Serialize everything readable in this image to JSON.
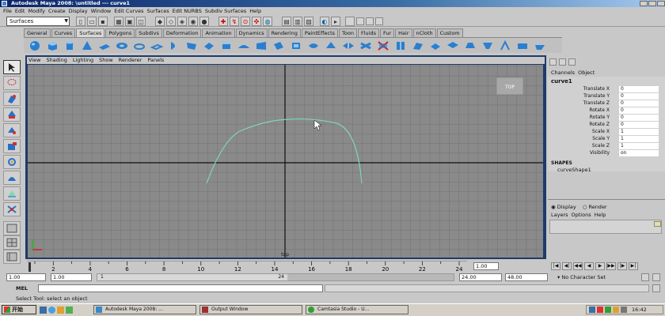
{
  "window": {
    "title": "Autodesk Maya 2008: \\untitled   ---   curve1"
  },
  "menubar": [
    "File",
    "Edit",
    "Modify",
    "Create",
    "Display",
    "Window",
    "Edit Curves",
    "Surfaces",
    "Edit NURBS",
    "Subdiv Surfaces",
    "Help"
  ],
  "status_line": {
    "mode": "Surfaces"
  },
  "shelf": {
    "tabs": [
      "General",
      "Curves",
      "Surfaces",
      "Polygons",
      "Subdivs",
      "Deformation",
      "Animation",
      "Dynamics",
      "Rendering",
      "PaintEffects",
      "Toon",
      "Fluids",
      "Fur",
      "Hair",
      "nCloth",
      "Custom"
    ],
    "active_tab": "Surfaces"
  },
  "panel_menu": [
    "View",
    "Shading",
    "Lighting",
    "Show",
    "Renderer",
    "Panels"
  ],
  "viewport": {
    "view_cube_label": "TOP",
    "camera_label": "top",
    "curve_color": "#7fd6b8"
  },
  "channel_box": {
    "menu": [
      "Channels",
      "Object"
    ],
    "object_name": "curve1",
    "attributes": [
      {
        "label": "Translate X",
        "value": "0"
      },
      {
        "label": "Translate Y",
        "value": "0"
      },
      {
        "label": "Translate Z",
        "value": "0"
      },
      {
        "label": "Rotate X",
        "value": "0"
      },
      {
        "label": "Rotate Y",
        "value": "0"
      },
      {
        "label": "Rotate Z",
        "value": "0"
      },
      {
        "label": "Scale X",
        "value": "1"
      },
      {
        "label": "Scale Y",
        "value": "1"
      },
      {
        "label": "Scale Z",
        "value": "1"
      },
      {
        "label": "Visibility",
        "value": "on"
      }
    ],
    "shapes_header": "SHAPES",
    "shape_name": "curveShape1"
  },
  "layer_editor": {
    "display_option": "Display",
    "render_option": "Render",
    "menu": [
      "Layers",
      "Options",
      "Help"
    ]
  },
  "timeline": {
    "ticks": [
      "2",
      "4",
      "6",
      "8",
      "10",
      "12",
      "14",
      "16",
      "18",
      "20",
      "22",
      "24"
    ],
    "current_frame": "1.00"
  },
  "range": {
    "start": "1.00",
    "playback_start": "1.00",
    "range_start_label": "1",
    "range_end_label": "24",
    "playback_end": "24.00",
    "end": "48.00",
    "character_set": "No Character Set"
  },
  "command_line": {
    "label": "MEL"
  },
  "help_line": {
    "text": "Select Tool: select an object"
  },
  "taskbar": {
    "start": "开始",
    "tasks": [
      {
        "label": "Autodesk Maya 2008: ..."
      },
      {
        "label": "Output Window"
      },
      {
        "label": "Camtasia Studio - U..."
      }
    ],
    "clock": "16:42"
  }
}
